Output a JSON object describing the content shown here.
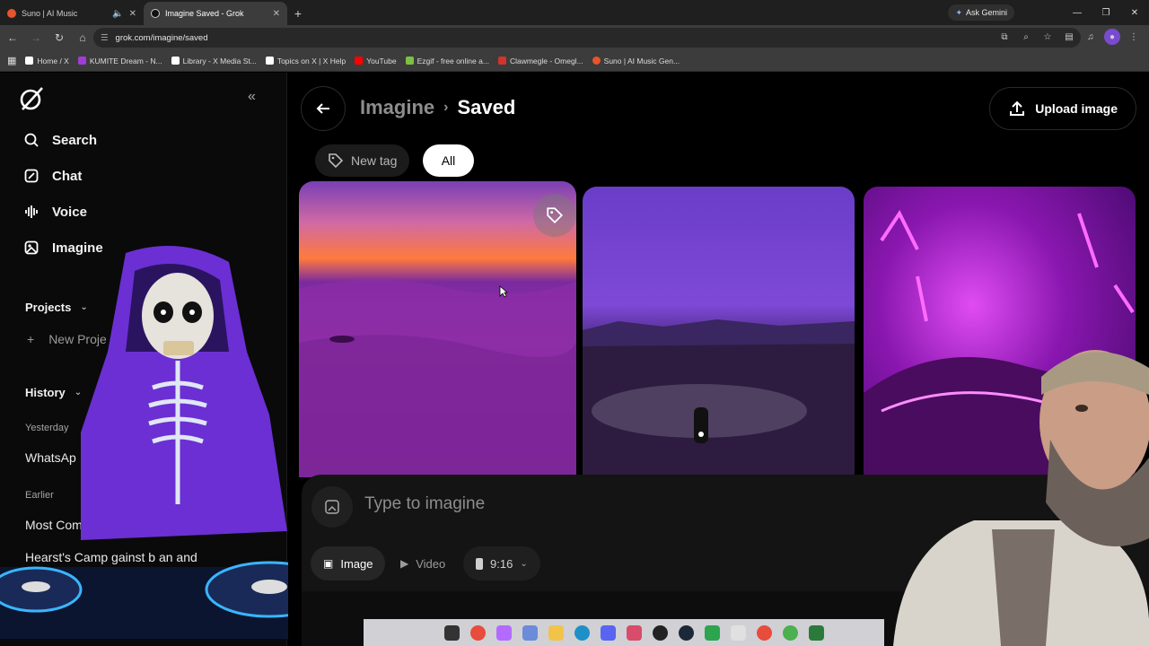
{
  "browser": {
    "tabs": [
      {
        "title": "Suno | AI Music",
        "active": false,
        "favicon_color": "#e8542b"
      },
      {
        "title": "Imagine Saved - Grok",
        "active": true,
        "favicon_color": "#dddddd"
      }
    ],
    "gemini_label": "Ask Gemini",
    "url": "grok.com/imagine/saved",
    "bookmarks": [
      {
        "label": "Home / X",
        "color": "#ffffff"
      },
      {
        "label": "KUMITE Dream - N...",
        "color": "#a13cd6"
      },
      {
        "label": "Library - X Media St...",
        "color": "#ffffff"
      },
      {
        "label": "Topics on X | X Help",
        "color": "#ffffff"
      },
      {
        "label": "YouTube",
        "color": "#ff0000"
      },
      {
        "label": "Ezgif - free online a...",
        "color": "#7cc142"
      },
      {
        "label": "Clawmegle - Omegl...",
        "color": "#d0342c"
      },
      {
        "label": "Suno | AI Music Gen...",
        "color": "#e8542b"
      }
    ]
  },
  "sidebar": {
    "nav": [
      {
        "label": "Search",
        "icon": "search-icon"
      },
      {
        "label": "Chat",
        "icon": "chat-icon"
      },
      {
        "label": "Voice",
        "icon": "voice-icon"
      },
      {
        "label": "Imagine",
        "icon": "imagine-icon"
      }
    ],
    "projects_label": "Projects",
    "new_project_label": "New Proje",
    "history_label": "History",
    "yesterday_label": "Yesterday",
    "yesterday_items": [
      "WhatsAp"
    ],
    "earlier_label": "Earlier",
    "earlier_items": [
      "Most Comple          s: I    s vs Othe",
      "Hearst's Camp       gainst b    an and"
    ]
  },
  "main": {
    "breadcrumb_parent": "Imagine",
    "breadcrumb_sep": "›",
    "breadcrumb_current": "Saved",
    "upload_label": "Upload image",
    "new_tag_label": "New tag",
    "all_label": "All",
    "composer_placeholder": "Type to imagine",
    "mode_image": "Image",
    "mode_video": "Video",
    "aspect_ratio": "9:16"
  },
  "colors": {
    "accent": "#ffffff",
    "background": "#000000",
    "panel": "#141414"
  }
}
